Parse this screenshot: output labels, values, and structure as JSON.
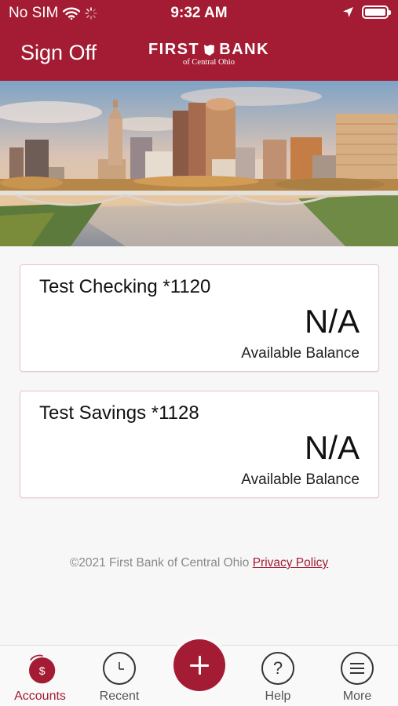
{
  "status_bar": {
    "carrier": "No SIM",
    "time": "9:32 AM",
    "icons": [
      "wifi-icon",
      "activity-spinner-icon",
      "location-arrow-icon",
      "battery-icon"
    ]
  },
  "header": {
    "sign_off_label": "Sign Off",
    "logo_name_left": "FIRST",
    "logo_name_right": "BANK",
    "logo_subtitle": "of Central Ohio",
    "brand_color": "#a31c33"
  },
  "accounts": [
    {
      "name": "Test Checking *1120",
      "balance": "N/A",
      "balance_label": "Available Balance"
    },
    {
      "name": "Test Savings *1128",
      "balance": "N/A",
      "balance_label": "Available Balance"
    }
  ],
  "footer": {
    "copyright": "©2021 First Bank of Central Ohio",
    "privacy_link": "Privacy Policy"
  },
  "tab_bar": {
    "tabs": [
      {
        "label": "Accounts",
        "icon": "dollar-circle-icon",
        "active": true
      },
      {
        "label": "Recent",
        "icon": "clock-icon",
        "active": false
      },
      {
        "label": "",
        "icon": "plus-icon",
        "active": false
      },
      {
        "label": "Help",
        "icon": "question-icon",
        "active": false
      },
      {
        "label": "More",
        "icon": "menu-icon",
        "active": false
      }
    ]
  }
}
